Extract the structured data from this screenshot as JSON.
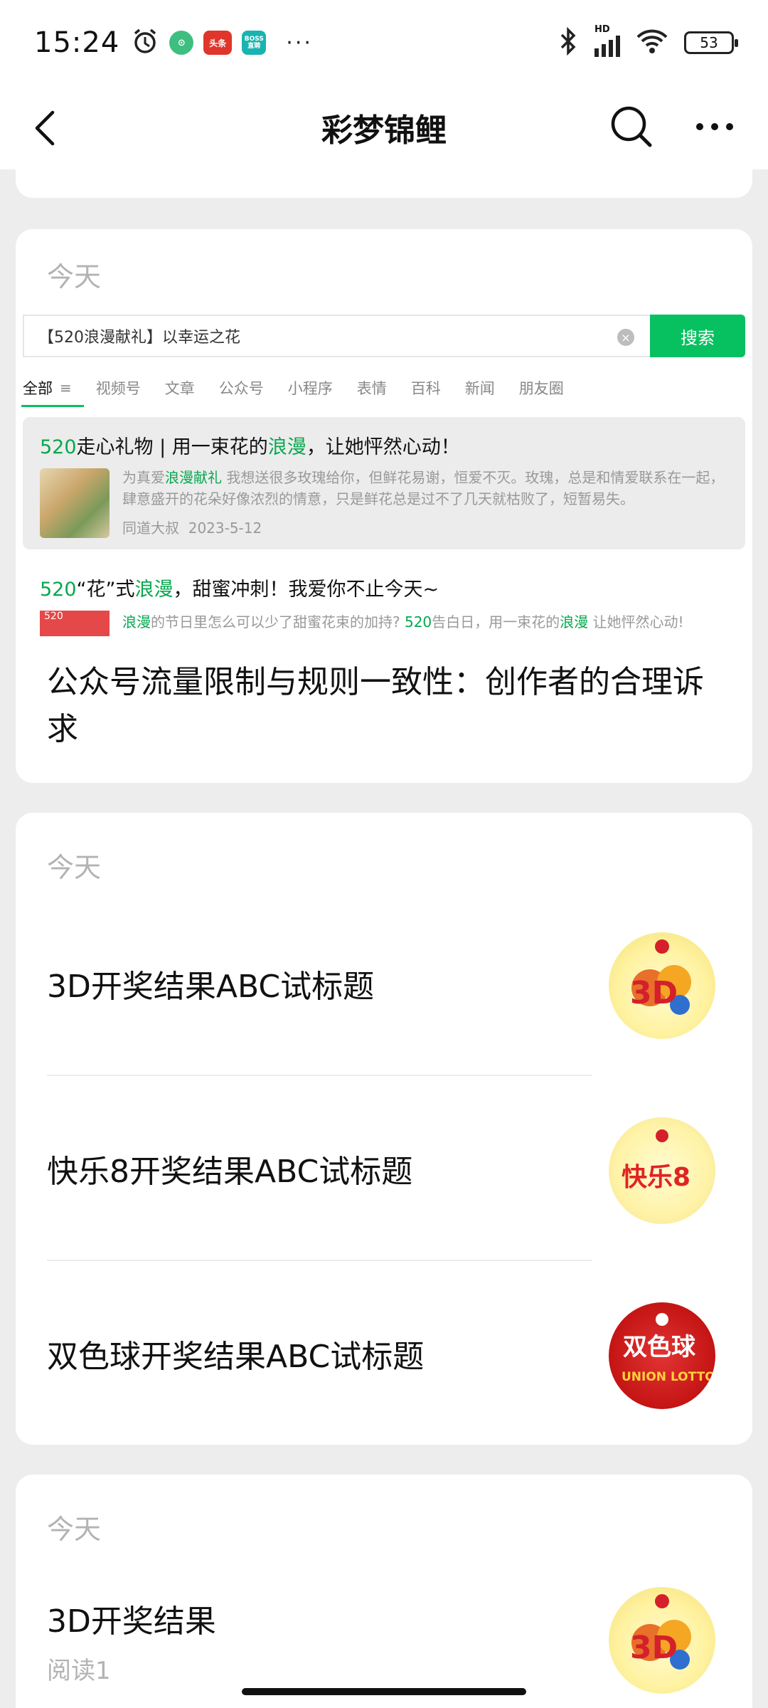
{
  "status_bar": {
    "time": "15:24",
    "app_badge_toutiao": "头条",
    "app_badge_boss": "BOSS直聘",
    "more": "···",
    "network": "HD",
    "battery": "53"
  },
  "nav": {
    "title": "彩梦锦鲤"
  },
  "card1": {
    "date": "今天",
    "embedded": {
      "search_query": "【520浪漫献礼】以幸运之花",
      "search_button": "搜索",
      "tabs": [
        "全部",
        "视频号",
        "文章",
        "公众号",
        "小程序",
        "表情",
        "百科",
        "新闻",
        "朋友圈"
      ],
      "result1": {
        "title_a": "520",
        "title_b": "走心礼物 | 用一束花的",
        "title_c": "浪漫",
        "title_d": "，让她怦然心动！",
        "body_a": "为真爱",
        "body_b": "浪漫献礼",
        "body_c": " 我想送很多玫瑰给你，但鲜花易谢，恒爱不灭。玫瑰，总是和情爱联系在一起，肆意盛开的花朵好像浓烈的情意，只是鲜花总是过不了几天就枯败了，短暂易失。",
        "author": "同道大叔",
        "date": "2023-5-12"
      },
      "result2": {
        "title_a": "520",
        "title_b": "“花”式",
        "title_c": "浪漫",
        "title_d": "，甜蜜冲刺！我爱你不止今天~",
        "body_a": "浪漫",
        "body_b": "的节日里怎么可以少了甜蜜花束的加持? ",
        "body_c": "520",
        "body_d": "告白日，用一束花的",
        "body_e": "浪漫",
        "body_f": " 让她怦然心动!",
        "thumb_text": "520"
      }
    },
    "title": "公众号流量限制与规则一致性：创作者的合理诉求"
  },
  "card2": {
    "date": "今天",
    "items": [
      {
        "title": "3D开奖结果ABC试标题",
        "thumb_text": "3D"
      },
      {
        "title": "快乐8开奖结果ABC试标题",
        "thumb_text": "快乐8"
      },
      {
        "title": "双色球开奖结果ABC试标题",
        "thumb_text": "双色球",
        "thumb_sub": "UNION LOTTO"
      }
    ]
  },
  "card3": {
    "date": "今天",
    "title": "3D开奖结果",
    "read": "阅读1",
    "thumb_text": "3D"
  },
  "colors": {
    "accent": "#07c160",
    "background": "#ededed",
    "card": "#ffffff",
    "muted": "#b3b3b3"
  }
}
